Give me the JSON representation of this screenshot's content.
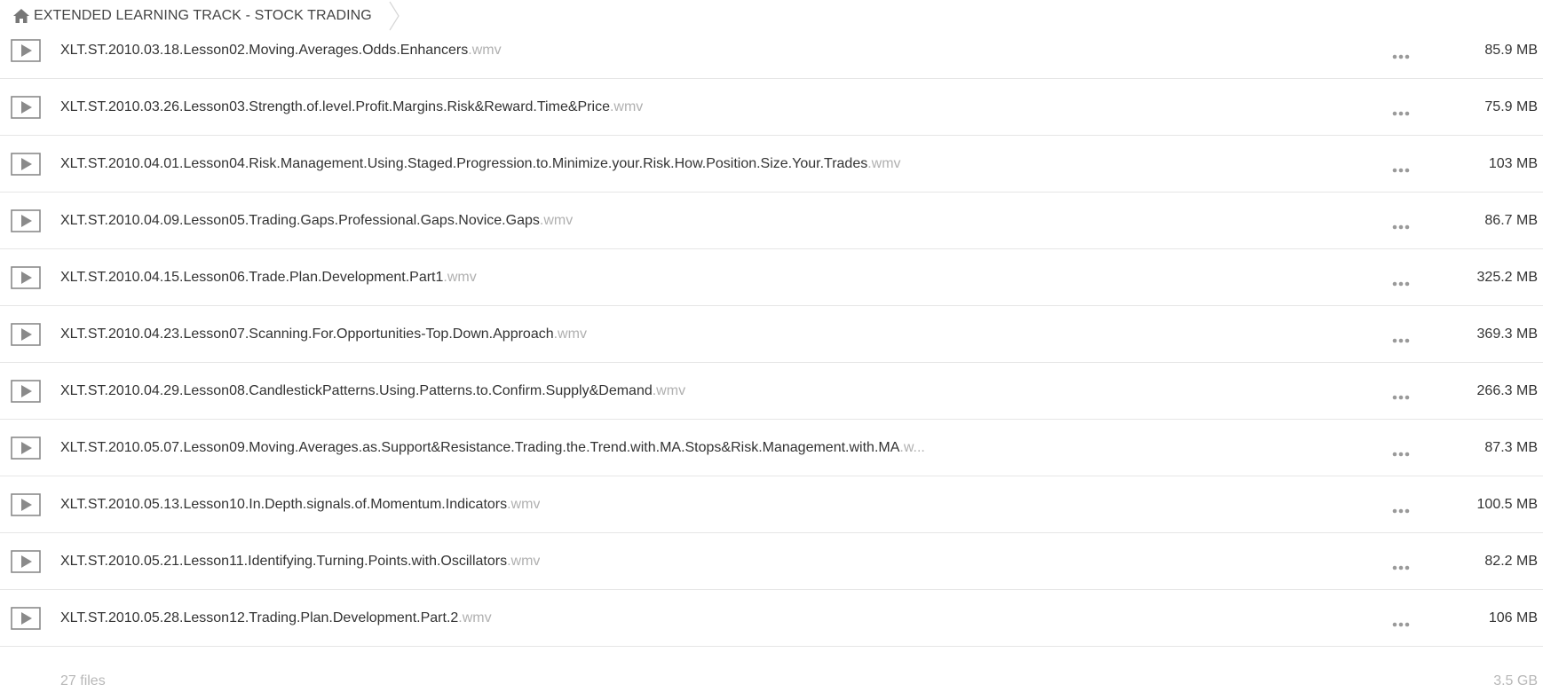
{
  "breadcrumb": {
    "home_icon": "home-icon",
    "label": "EXTENDED LEARNING TRACK - STOCK TRADING"
  },
  "files": [
    {
      "name": "XLT.ST.2010.03.18.Lesson02.Moving.Averages.Odds.Enhancers",
      "ext": ".wmv",
      "size": "85.9 MB"
    },
    {
      "name": "XLT.ST.2010.03.26.Lesson03.Strength.of.level.Profit.Margins.Risk&Reward.Time&Price",
      "ext": ".wmv",
      "size": "75.9 MB"
    },
    {
      "name": "XLT.ST.2010.04.01.Lesson04.Risk.Management.Using.Staged.Progression.to.Minimize.your.Risk.How.Position.Size.Your.Trades",
      "ext": ".wmv",
      "size": "103 MB"
    },
    {
      "name": "XLT.ST.2010.04.09.Lesson05.Trading.Gaps.Professional.Gaps.Novice.Gaps",
      "ext": ".wmv",
      "size": "86.7 MB"
    },
    {
      "name": "XLT.ST.2010.04.15.Lesson06.Trade.Plan.Development.Part1",
      "ext": ".wmv",
      "size": "325.2 MB"
    },
    {
      "name": "XLT.ST.2010.04.23.Lesson07.Scanning.For.Opportunities-Top.Down.Approach",
      "ext": ".wmv",
      "size": "369.3 MB"
    },
    {
      "name": "XLT.ST.2010.04.29.Lesson08.CandlestickPatterns.Using.Patterns.to.Confirm.Supply&Demand",
      "ext": ".wmv",
      "size": "266.3 MB"
    },
    {
      "name": "XLT.ST.2010.05.07.Lesson09.Moving.Averages.as.Support&Resistance.Trading.the.Trend.with.MA.Stops&Risk.Management.with.MA",
      "ext": ".w...",
      "size": "87.3 MB"
    },
    {
      "name": "XLT.ST.2010.05.13.Lesson10.In.Depth.signals.of.Momentum.Indicators",
      "ext": ".wmv",
      "size": "100.5 MB"
    },
    {
      "name": "XLT.ST.2010.05.21.Lesson11.Identifying.Turning.Points.with.Oscillators",
      "ext": ".wmv",
      "size": "82.2 MB"
    },
    {
      "name": "XLT.ST.2010.05.28.Lesson12.Trading.Plan.Development.Part.2",
      "ext": ".wmv",
      "size": "106 MB"
    }
  ],
  "icons": {
    "file": "play-icon",
    "row_menu": "more-icon"
  },
  "footer": {
    "count": "27 files",
    "total": "3.5 GB"
  },
  "colors": {
    "extension": "#b0b0b0",
    "divider": "#e6e6e6",
    "icon": "#8a8a8a"
  }
}
